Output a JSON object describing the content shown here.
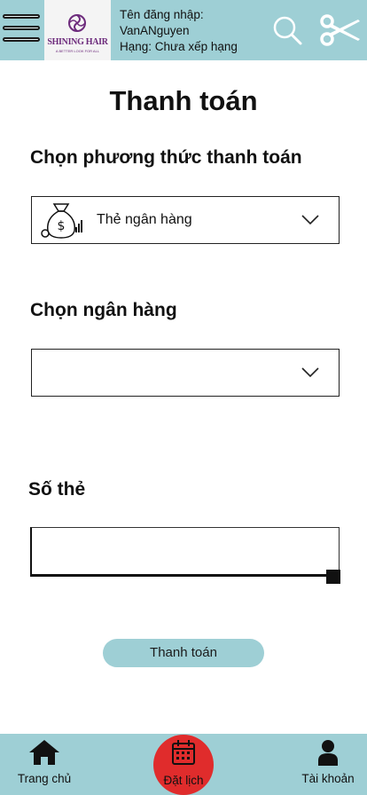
{
  "header": {
    "logo": {
      "brand": "SHINING HAIR",
      "tagline": "A BETTER LOOK FOR ALL"
    },
    "username_line": "Tên đăng nhập:",
    "username": "VanANguyen",
    "rank": "Hạng: Chưa xếp hạng",
    "icons": {
      "menu": "hamburger-menu-icon",
      "search": "search-icon",
      "booking": "scissors-icon"
    }
  },
  "page": {
    "title": "Thanh toán",
    "method_label": "Chọn phương thức thanh toán",
    "method_selected": "Thẻ ngân hàng",
    "method_icon": "money-bag-icon",
    "bank_label": "Chọn ngân hàng",
    "bank_selected": "",
    "card_label": "Số thẻ",
    "card_value": "",
    "pay_button": "Thanh toán"
  },
  "nav": {
    "home": {
      "label": "Trang chủ",
      "icon": "home-icon"
    },
    "booking": {
      "label": "Đặt lịch",
      "icon": "calendar-icon"
    },
    "account": {
      "label": "Tài khoản",
      "icon": "user-icon"
    }
  },
  "colors": {
    "accent": "#9ecfd5",
    "booking_red": "#e02c2c",
    "logo_purple": "#6d2b7c"
  }
}
